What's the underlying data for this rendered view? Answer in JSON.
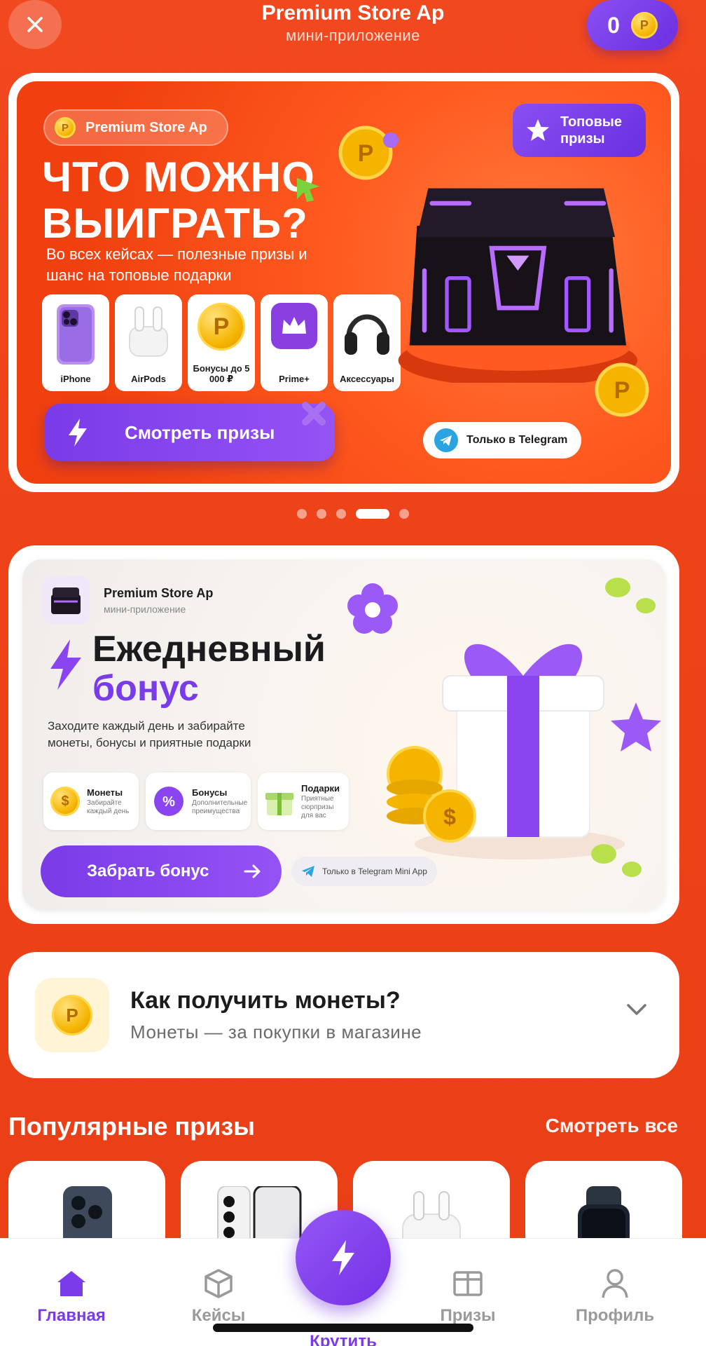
{
  "header": {
    "title": "Premium Store Ap",
    "subtitle": "мини-приложение",
    "balance": "0",
    "coin_symbol": "P"
  },
  "hero": {
    "brand": "Premium Store Ap",
    "headline_line1": "ЧТО МОЖНО",
    "headline_line2": "ВЫИГРАТЬ?",
    "subtitle": "Во всех кейсах — полезные призы и шанс на топовые подарки",
    "top_badge": "Топовые призы",
    "prizes": [
      {
        "label": "iPhone",
        "icon": "phone-icon"
      },
      {
        "label": "AirPods",
        "icon": "airpods-icon"
      },
      {
        "label": "Бонусы до 5 000 ₽",
        "icon": "coin-icon"
      },
      {
        "label": "Prime+",
        "icon": "crown-icon"
      },
      {
        "label": "Аксессуары",
        "icon": "headphones-icon"
      }
    ],
    "cta": "Смотреть призы",
    "telegram": "Только в Telegram",
    "active_slide": 4,
    "total_slides": 5
  },
  "bonus": {
    "app_name": "Premium Store Ap",
    "app_sub": "мини-приложение",
    "title_line1": "Ежедневный",
    "title_line2": "бонус",
    "subtitle": "Заходите каждый день и забирайте монеты, бонусы и приятные подарки",
    "cards": [
      {
        "title": "Монеты",
        "sub": "Забирайте каждый день"
      },
      {
        "title": "Бонусы",
        "sub": "Дополнительные преимущества"
      },
      {
        "title": "Подарки",
        "sub": "Приятные сюрпризы для вас"
      }
    ],
    "cta": "Забрать бонус",
    "telegram": "Только в Telegram Mini App"
  },
  "coins": {
    "question": "Как получить монеты?",
    "answer": "Монеты — за покупки в магазине"
  },
  "popular": {
    "title": "Популярные призы",
    "see_all": "Смотреть все"
  },
  "nav": {
    "home": "Главная",
    "cases": "Кейсы",
    "spin": "Крутить",
    "prizes": "Призы",
    "profile": "Профиль"
  },
  "colors": {
    "background": "#ee4319",
    "accent": "#7a3be8",
    "coin": "#f5b400"
  }
}
